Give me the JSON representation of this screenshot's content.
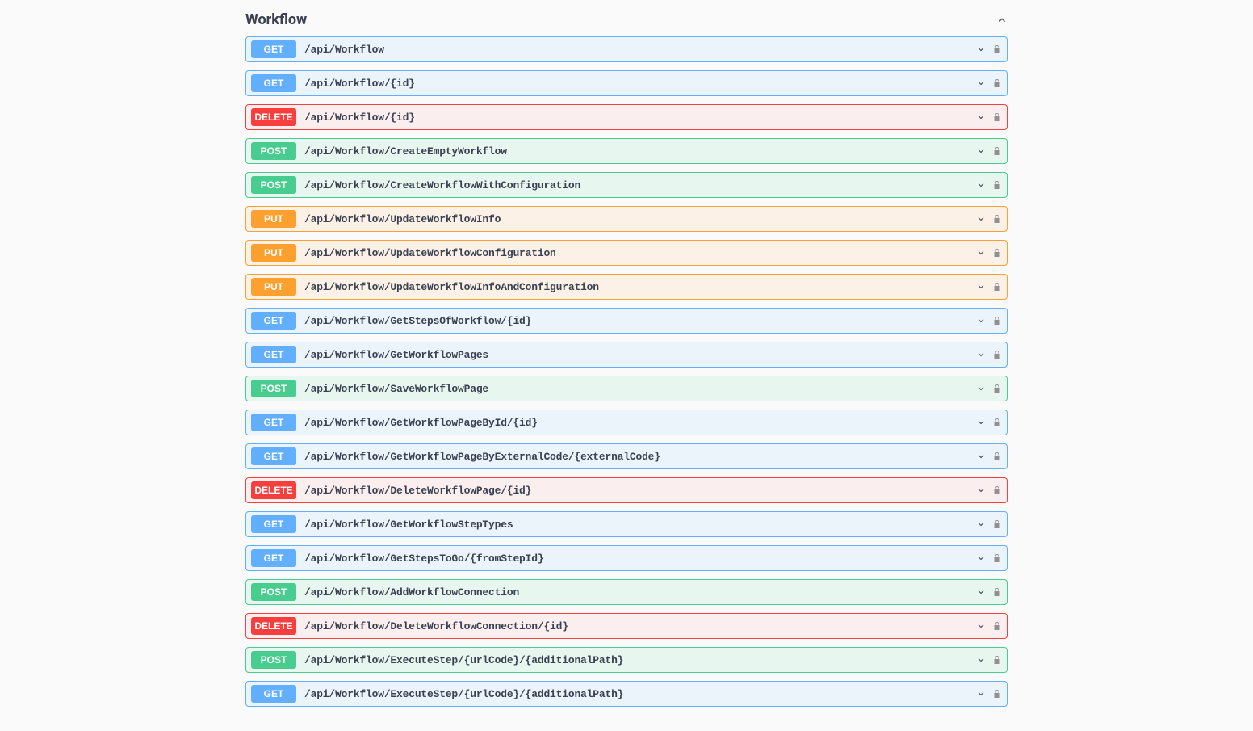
{
  "section": {
    "title": "Workflow"
  },
  "endpoints": [
    {
      "method": "GET",
      "path": "/api/Workflow"
    },
    {
      "method": "GET",
      "path": "/api/Workflow/{id}"
    },
    {
      "method": "DELETE",
      "path": "/api/Workflow/{id}"
    },
    {
      "method": "POST",
      "path": "/api/Workflow/CreateEmptyWorkflow"
    },
    {
      "method": "POST",
      "path": "/api/Workflow/CreateWorkflowWithConfiguration"
    },
    {
      "method": "PUT",
      "path": "/api/Workflow/UpdateWorkflowInfo"
    },
    {
      "method": "PUT",
      "path": "/api/Workflow/UpdateWorkflowConfiguration"
    },
    {
      "method": "PUT",
      "path": "/api/Workflow/UpdateWorkflowInfoAndConfiguration"
    },
    {
      "method": "GET",
      "path": "/api/Workflow/GetStepsOfWorkflow/{id}"
    },
    {
      "method": "GET",
      "path": "/api/Workflow/GetWorkflowPages"
    },
    {
      "method": "POST",
      "path": "/api/Workflow/SaveWorkflowPage"
    },
    {
      "method": "GET",
      "path": "/api/Workflow/GetWorkflowPageById/{id}"
    },
    {
      "method": "GET",
      "path": "/api/Workflow/GetWorkflowPageByExternalCode/{externalCode}"
    },
    {
      "method": "DELETE",
      "path": "/api/Workflow/DeleteWorkflowPage/{id}"
    },
    {
      "method": "GET",
      "path": "/api/Workflow/GetWorkflowStepTypes"
    },
    {
      "method": "GET",
      "path": "/api/Workflow/GetStepsToGo/{fromStepId}"
    },
    {
      "method": "POST",
      "path": "/api/Workflow/AddWorkflowConnection"
    },
    {
      "method": "DELETE",
      "path": "/api/Workflow/DeleteWorkflowConnection/{id}"
    },
    {
      "method": "POST",
      "path": "/api/Workflow/ExecuteStep/{urlCode}/{additionalPath}"
    },
    {
      "method": "GET",
      "path": "/api/Workflow/ExecuteStep/{urlCode}/{additionalPath}"
    }
  ]
}
